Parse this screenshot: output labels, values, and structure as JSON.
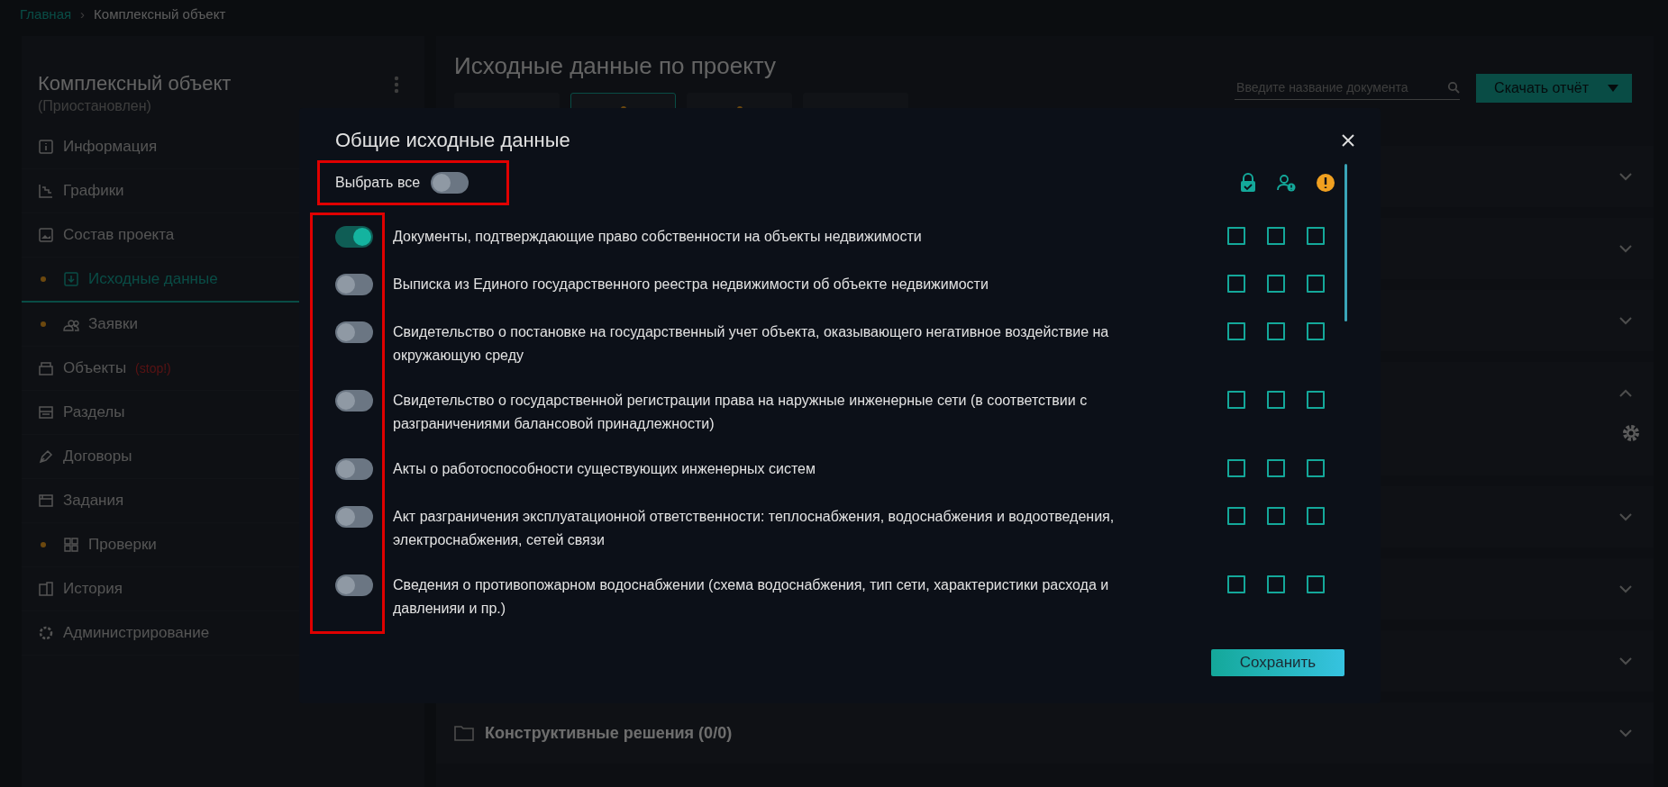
{
  "breadcrumb": {
    "items": [
      {
        "label": "Главная",
        "link": true
      },
      {
        "label": "Комплексный объект",
        "link": false
      }
    ],
    "separator": "›"
  },
  "sidebar": {
    "title": "Комплексный объект",
    "status": "(Приостановлен)",
    "items": [
      {
        "label": "Информация",
        "kind": "info",
        "selected": false,
        "dot": false
      },
      {
        "label": "Графики",
        "kind": "chart",
        "selected": false,
        "dot": false
      },
      {
        "label": "Состав проекта",
        "kind": "image",
        "selected": false,
        "dot": false
      },
      {
        "label": "Исходные данные",
        "kind": "download",
        "selected": true,
        "dot": true
      },
      {
        "label": "Заявки",
        "kind": "people",
        "selected": false,
        "dot": true
      },
      {
        "label": "Объекты",
        "kind": "box",
        "selected": false,
        "dot": false,
        "badge": "(stop!)"
      },
      {
        "label": "Разделы",
        "kind": "list",
        "selected": false,
        "dot": false
      },
      {
        "label": "Договоры",
        "kind": "pen",
        "selected": false,
        "dot": false
      },
      {
        "label": "Задания",
        "kind": "task",
        "selected": false,
        "dot": false
      },
      {
        "label": "Проверки",
        "kind": "grid",
        "selected": false,
        "dot": true
      },
      {
        "label": "История",
        "kind": "history",
        "selected": false,
        "dot": false
      },
      {
        "label": "Администрирование",
        "kind": "gear",
        "selected": false,
        "dot": false
      }
    ]
  },
  "main": {
    "title": "Исходные данные по проекту",
    "search": {
      "placeholder": "Введите название документа"
    },
    "download_button": "Скачать отчёт",
    "tabs": [
      {
        "selected": false,
        "dot": false
      },
      {
        "selected": true,
        "dot": true
      },
      {
        "selected": false,
        "dot": true
      },
      {
        "selected": false,
        "dot": false
      }
    ],
    "sections": [
      {
        "expanded": false
      },
      {
        "expanded": false
      },
      {
        "expanded": false
      },
      {
        "expanded": true
      },
      {
        "expanded": false
      },
      {
        "expanded": false
      },
      {
        "expanded": false
      },
      {
        "expanded": false,
        "title": "Конструктивные решения (0/0)"
      }
    ]
  },
  "modal": {
    "title": "Общие исходные данные",
    "select_all": {
      "label": "Выбрать все",
      "on": false
    },
    "items": [
      {
        "text": "Документы, подтверждающие право собственности на объекты недвижимости",
        "on": true,
        "checks": [
          false,
          false,
          false
        ]
      },
      {
        "text": "Выписка из Единого государственного реестра недвижимости об объекте недвижимости",
        "on": false,
        "checks": [
          false,
          false,
          false
        ]
      },
      {
        "text": "Свидетельство о постановке на государственный учет объекта, оказывающего негативное воздействие на окружающую среду",
        "on": false,
        "checks": [
          false,
          false,
          false
        ]
      },
      {
        "text": "Свидетельство о государственной регистрации права на наружные инженерные сети (в соответствии с разграничениями балансовой принадлежности)",
        "on": false,
        "checks": [
          false,
          false,
          false
        ]
      },
      {
        "text": "Акты о работоспособности существующих инженерных систем",
        "on": false,
        "checks": [
          false,
          false,
          false
        ]
      },
      {
        "text": "Акт разграничения эксплуатационной ответственности: теплоснабжения, водоснабжения и водоотведения, электроснабжения, сетей связи",
        "on": false,
        "checks": [
          false,
          false,
          false
        ]
      },
      {
        "text": "Сведения о противопожарном водоснабжении (схема водоснабжения, тип сети, характеристики расхода и давленияи и пр.)",
        "on": false,
        "checks": [
          false,
          false,
          false
        ]
      }
    ],
    "save_button": "Сохранить"
  }
}
